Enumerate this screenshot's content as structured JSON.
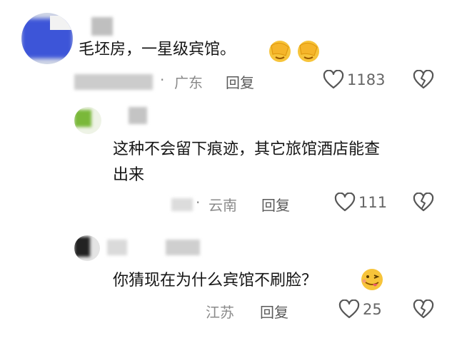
{
  "comments": [
    {
      "text": "毛坯房，一星级宾馆。",
      "location": "广东",
      "reply_label": "回复",
      "likes": "1183"
    },
    {
      "text_line1": "这种不会留下痕迹，其它旅馆酒店能查",
      "text_line2": "出来",
      "location": "云南",
      "reply_label": "回复",
      "likes": "111"
    },
    {
      "text": "你猜现在为什么宾馆不刷脸？",
      "location": "江苏",
      "reply_label": "回复",
      "likes": "25"
    }
  ],
  "meta_separator": "·"
}
